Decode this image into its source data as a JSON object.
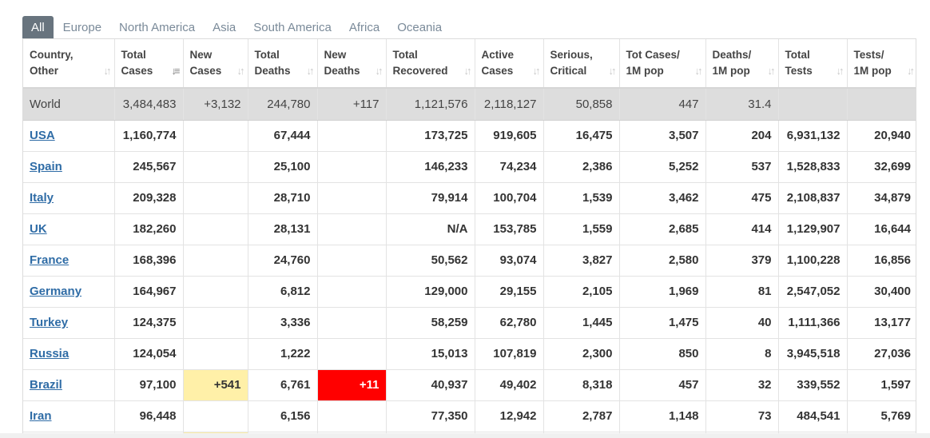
{
  "tabs": [
    {
      "label": "All",
      "active": true
    },
    {
      "label": "Europe"
    },
    {
      "label": "North America"
    },
    {
      "label": "Asia"
    },
    {
      "label": "South America"
    },
    {
      "label": "Africa"
    },
    {
      "label": "Oceania"
    }
  ],
  "columns": [
    {
      "line1": "Country,",
      "line2": "Other"
    },
    {
      "line1": "Total",
      "line2": "Cases",
      "sorted": true
    },
    {
      "line1": "New",
      "line2": "Cases"
    },
    {
      "line1": "Total",
      "line2": "Deaths"
    },
    {
      "line1": "New",
      "line2": "Deaths"
    },
    {
      "line1": "Total",
      "line2": "Recovered"
    },
    {
      "line1": "Active",
      "line2": "Cases"
    },
    {
      "line1": "Serious,",
      "line2": "Critical"
    },
    {
      "line1": "Tot Cases/",
      "line2": "1M pop"
    },
    {
      "line1": "Deaths/",
      "line2": "1M pop"
    },
    {
      "line1": "Total",
      "line2": "Tests"
    },
    {
      "line1": "Tests/",
      "line2": "1M pop"
    }
  ],
  "world_row": {
    "country": "World",
    "total_cases": "3,484,483",
    "new_cases": "+3,132",
    "total_deaths": "244,780",
    "new_deaths": "+117",
    "total_recovered": "1,121,576",
    "active_cases": "2,118,127",
    "serious": "50,858",
    "cases_per_1m": "447",
    "deaths_per_1m": "31.4",
    "total_tests": "",
    "tests_per_1m": ""
  },
  "rows": [
    {
      "country": "USA",
      "total_cases": "1,160,774",
      "new_cases": "",
      "total_deaths": "67,444",
      "new_deaths": "",
      "total_recovered": "173,725",
      "active_cases": "919,605",
      "serious": "16,475",
      "cases_per_1m": "3,507",
      "deaths_per_1m": "204",
      "total_tests": "6,931,132",
      "tests_per_1m": "20,940"
    },
    {
      "country": "Spain",
      "total_cases": "245,567",
      "new_cases": "",
      "total_deaths": "25,100",
      "new_deaths": "",
      "total_recovered": "146,233",
      "active_cases": "74,234",
      "serious": "2,386",
      "cases_per_1m": "5,252",
      "deaths_per_1m": "537",
      "total_tests": "1,528,833",
      "tests_per_1m": "32,699"
    },
    {
      "country": "Italy",
      "total_cases": "209,328",
      "new_cases": "",
      "total_deaths": "28,710",
      "new_deaths": "",
      "total_recovered": "79,914",
      "active_cases": "100,704",
      "serious": "1,539",
      "cases_per_1m": "3,462",
      "deaths_per_1m": "475",
      "total_tests": "2,108,837",
      "tests_per_1m": "34,879"
    },
    {
      "country": "UK",
      "total_cases": "182,260",
      "new_cases": "",
      "total_deaths": "28,131",
      "new_deaths": "",
      "total_recovered": "N/A",
      "active_cases": "153,785",
      "serious": "1,559",
      "cases_per_1m": "2,685",
      "deaths_per_1m": "414",
      "total_tests": "1,129,907",
      "tests_per_1m": "16,644"
    },
    {
      "country": "France",
      "total_cases": "168,396",
      "new_cases": "",
      "total_deaths": "24,760",
      "new_deaths": "",
      "total_recovered": "50,562",
      "active_cases": "93,074",
      "serious": "3,827",
      "cases_per_1m": "2,580",
      "deaths_per_1m": "379",
      "total_tests": "1,100,228",
      "tests_per_1m": "16,856"
    },
    {
      "country": "Germany",
      "total_cases": "164,967",
      "new_cases": "",
      "total_deaths": "6,812",
      "new_deaths": "",
      "total_recovered": "129,000",
      "active_cases": "29,155",
      "serious": "2,105",
      "cases_per_1m": "1,969",
      "deaths_per_1m": "81",
      "total_tests": "2,547,052",
      "tests_per_1m": "30,400"
    },
    {
      "country": "Turkey",
      "total_cases": "124,375",
      "new_cases": "",
      "total_deaths": "3,336",
      "new_deaths": "",
      "total_recovered": "58,259",
      "active_cases": "62,780",
      "serious": "1,445",
      "cases_per_1m": "1,475",
      "deaths_per_1m": "40",
      "total_tests": "1,111,366",
      "tests_per_1m": "13,177"
    },
    {
      "country": "Russia",
      "total_cases": "124,054",
      "new_cases": "",
      "total_deaths": "1,222",
      "new_deaths": "",
      "total_recovered": "15,013",
      "active_cases": "107,819",
      "serious": "2,300",
      "cases_per_1m": "850",
      "deaths_per_1m": "8",
      "total_tests": "3,945,518",
      "tests_per_1m": "27,036"
    },
    {
      "country": "Brazil",
      "total_cases": "97,100",
      "new_cases": "+541",
      "total_deaths": "6,761",
      "new_deaths": "+11",
      "total_recovered": "40,937",
      "active_cases": "49,402",
      "serious": "8,318",
      "cases_per_1m": "457",
      "deaths_per_1m": "32",
      "total_tests": "339,552",
      "tests_per_1m": "1,597"
    },
    {
      "country": "Iran",
      "total_cases": "96,448",
      "new_cases": "",
      "total_deaths": "6,156",
      "new_deaths": "",
      "total_recovered": "77,350",
      "active_cases": "12,942",
      "serious": "2,787",
      "cases_per_1m": "1,148",
      "deaths_per_1m": "73",
      "total_tests": "484,541",
      "tests_per_1m": "5,769"
    }
  ],
  "highlight_colors": {
    "new_cases": "#fff0a8",
    "new_deaths": "#ff0000",
    "world_row": "#dddddd",
    "link": "#2f6ca6",
    "active_tab": "#68747e"
  }
}
